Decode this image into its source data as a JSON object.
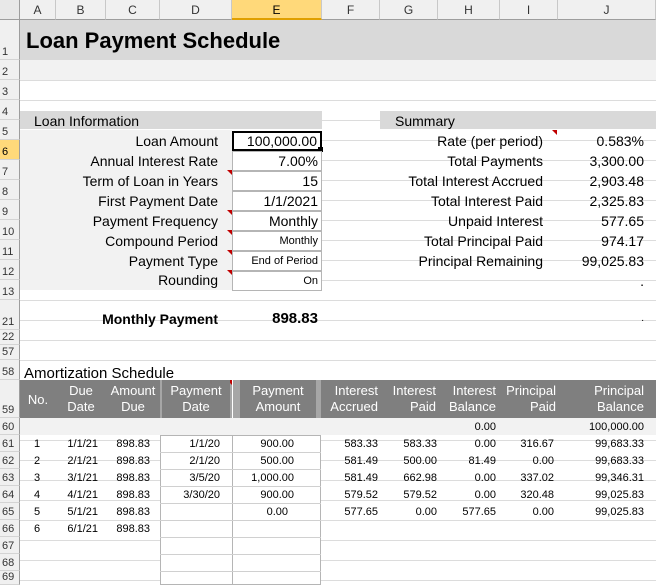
{
  "columns": [
    "A",
    "B",
    "C",
    "D",
    "E",
    "F",
    "G",
    "H",
    "I",
    "J"
  ],
  "rows": [
    "1",
    "2",
    "3",
    "4",
    "5",
    "6",
    "7",
    "8",
    "9",
    "10",
    "11",
    "12",
    "13",
    "21",
    "22",
    "57",
    "58",
    "59",
    "60",
    "61",
    "62",
    "63",
    "64",
    "65",
    "66",
    "67",
    "68",
    "69"
  ],
  "title": "Loan Payment Schedule",
  "loan_info": {
    "heading": "Loan Information",
    "labels": [
      "Loan Amount",
      "Annual Interest Rate",
      "Term of Loan in Years",
      "First Payment Date",
      "Payment Frequency",
      "Compound Period",
      "Payment Type",
      "Rounding"
    ],
    "values": [
      "100,000.00",
      "7.00%",
      "15",
      "1/1/2021",
      "Monthly",
      "Monthly",
      "End of Period",
      "On"
    ]
  },
  "summary": {
    "heading": "Summary",
    "labels": [
      "Rate (per period)",
      "Total Payments",
      "Total Interest Accrued",
      "Total Interest Paid",
      "Unpaid Interest",
      "Total Principal Paid",
      "Principal Remaining"
    ],
    "values": [
      "0.583%",
      "3,300.00",
      "2,903.48",
      "2,325.83",
      "577.65",
      "974.17",
      "99,025.83"
    ],
    "extra": [
      ".",
      "."
    ]
  },
  "monthly_payment": {
    "label": "Monthly Payment",
    "value": "898.83"
  },
  "amortization": {
    "heading": "Amortization Schedule",
    "headers": [
      "No.",
      "Due Date",
      "Amount Due",
      "Payment Date",
      "Payment Amount",
      "Interest Accrued",
      "Interest Paid",
      "Interest Balance",
      "Principal Paid",
      "Principal Balance"
    ],
    "initial_row": {
      "interest_balance": "0.00",
      "principal_balance": "100,000.00"
    },
    "rows": [
      {
        "no": "1",
        "due": "1/1/21",
        "amount": "898.83",
        "pdate": "1/1/20",
        "pamt": "900.00",
        "iacc": "583.33",
        "ipaid": "583.33",
        "ibal": "0.00",
        "ppaid": "316.67",
        "pbal": "99,683.33"
      },
      {
        "no": "2",
        "due": "2/1/21",
        "amount": "898.83",
        "pdate": "2/1/20",
        "pamt": "500.00",
        "iacc": "581.49",
        "ipaid": "500.00",
        "ibal": "81.49",
        "ppaid": "0.00",
        "pbal": "99,683.33"
      },
      {
        "no": "3",
        "due": "3/1/21",
        "amount": "898.83",
        "pdate": "3/5/20",
        "pamt": "1,000.00",
        "iacc": "581.49",
        "ipaid": "662.98",
        "ibal": "0.00",
        "ppaid": "337.02",
        "pbal": "99,346.31"
      },
      {
        "no": "4",
        "due": "4/1/21",
        "amount": "898.83",
        "pdate": "3/30/20",
        "pamt": "900.00",
        "iacc": "579.52",
        "ipaid": "579.52",
        "ibal": "0.00",
        "ppaid": "320.48",
        "pbal": "99,025.83"
      },
      {
        "no": "5",
        "due": "5/1/21",
        "amount": "898.83",
        "pdate": "",
        "pamt": "0.00",
        "iacc": "577.65",
        "ipaid": "0.00",
        "ibal": "577.65",
        "ppaid": "0.00",
        "pbal": "99,025.83"
      },
      {
        "no": "6",
        "due": "6/1/21",
        "amount": "898.83",
        "pdate": "",
        "pamt": "",
        "iacc": "",
        "ipaid": "",
        "ibal": "",
        "ppaid": "",
        "pbal": ""
      }
    ]
  }
}
